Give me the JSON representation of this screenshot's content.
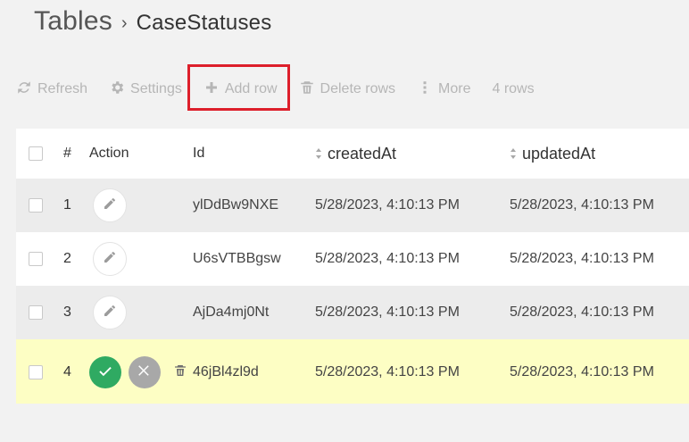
{
  "breadcrumb": {
    "root": "Tables",
    "separator": "›",
    "current": "CaseStatuses"
  },
  "toolbar": {
    "refresh": {
      "label": "Refresh",
      "icon": "refresh-icon"
    },
    "settings": {
      "label": "Settings",
      "icon": "gear-icon"
    },
    "add_row": {
      "label": "Add row",
      "icon": "plus-icon"
    },
    "delete_rows": {
      "label": "Delete rows",
      "icon": "trash-icon"
    },
    "more": {
      "label": "More",
      "icon": "more-vertical-icon"
    },
    "rows_count": "4 rows"
  },
  "highlight": {
    "target": "toolbar.add_row",
    "color": "#dd1f2b"
  },
  "table": {
    "columns": [
      {
        "key": "checkbox",
        "label": ""
      },
      {
        "key": "num",
        "label": "#"
      },
      {
        "key": "action",
        "label": "Action"
      },
      {
        "key": "id",
        "label": "Id"
      },
      {
        "key": "createdAt",
        "label": "createdAt",
        "sortable": true
      },
      {
        "key": "updatedAt",
        "label": "updatedAt",
        "sortable": true
      }
    ],
    "rows": [
      {
        "num": "1",
        "id": "ylDdBw9NXE",
        "createdAt": "5/28/2023, 4:10:13 PM",
        "updatedAt": "5/28/2023, 4:10:13 PM",
        "state": "view"
      },
      {
        "num": "2",
        "id": "U6sVTBBgsw",
        "createdAt": "5/28/2023, 4:10:13 PM",
        "updatedAt": "5/28/2023, 4:10:13 PM",
        "state": "view"
      },
      {
        "num": "3",
        "id": "AjDa4mj0Nt",
        "createdAt": "5/28/2023, 4:10:13 PM",
        "updatedAt": "5/28/2023, 4:10:13 PM",
        "state": "view"
      },
      {
        "num": "4",
        "id": "46jBl4zl9d",
        "createdAt": "5/28/2023, 4:10:13 PM",
        "updatedAt": "5/28/2023, 4:10:13 PM",
        "state": "edit"
      }
    ]
  },
  "colors": {
    "background": "#f2f2f2",
    "table_bg": "#ffffff",
    "row_gray": "#ececec",
    "row_edit": "#fdfec4",
    "toolbar_text": "#b6b6b6",
    "confirm": "#2faa62",
    "cancel": "#a8a8a8"
  }
}
